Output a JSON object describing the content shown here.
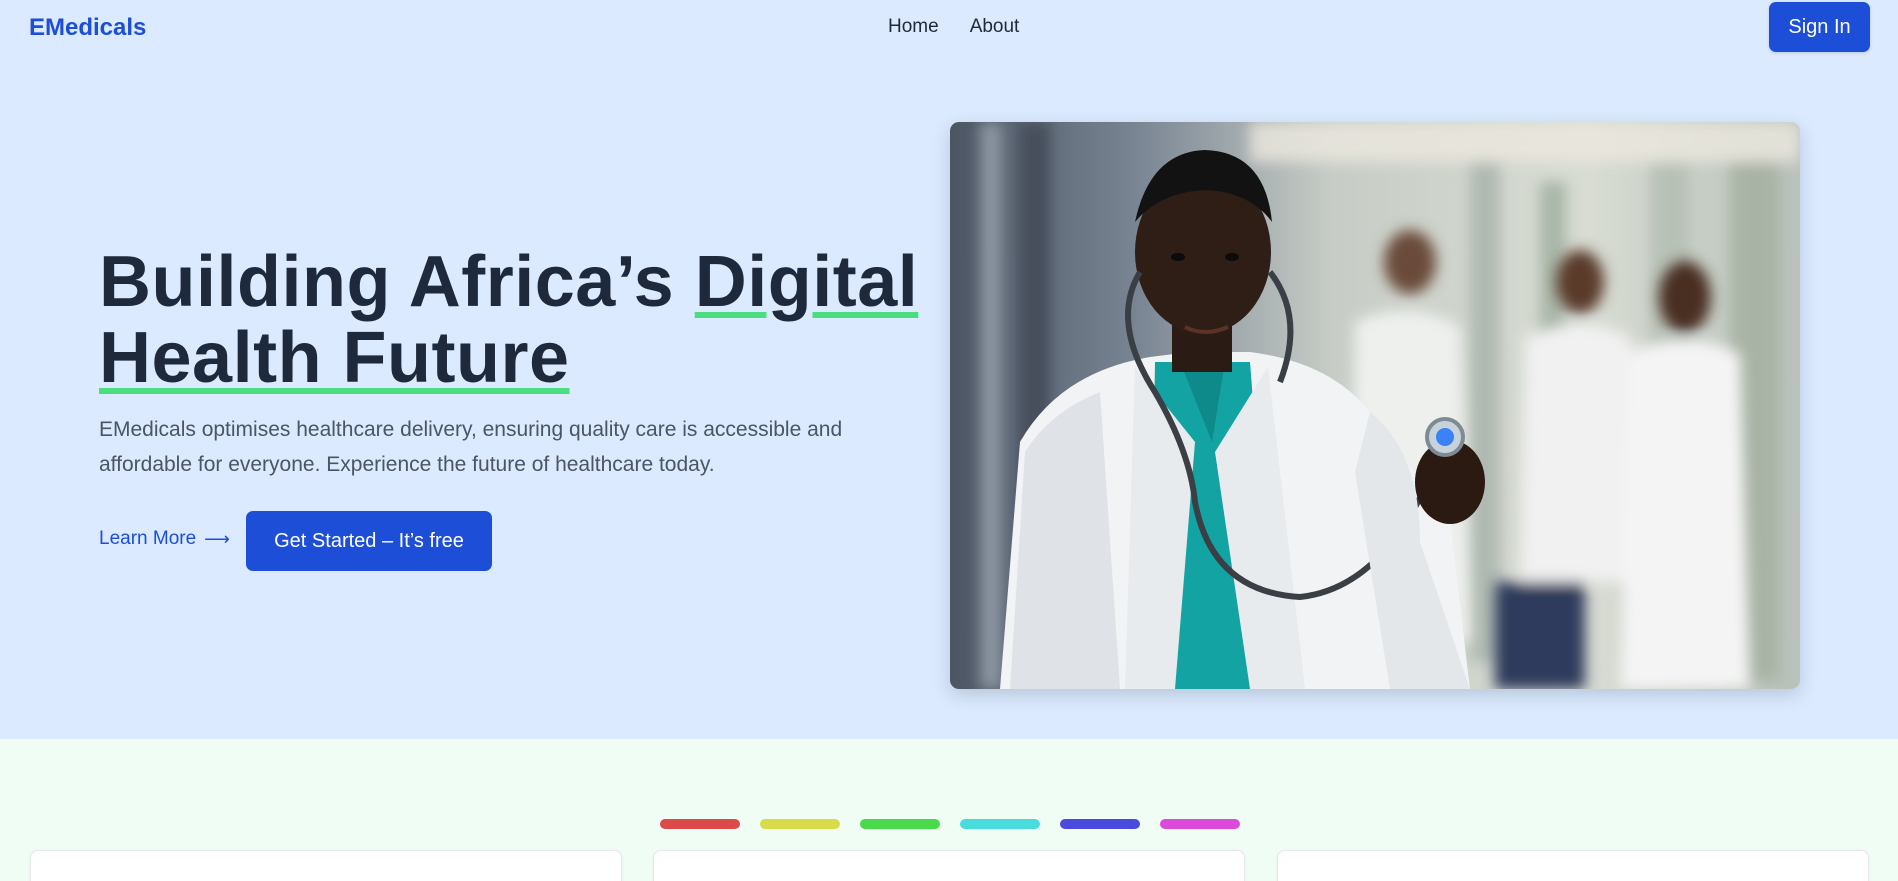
{
  "brand": "EMedicals",
  "nav": {
    "items": [
      {
        "label": "Home"
      },
      {
        "label": "About"
      }
    ],
    "sign_in": "Sign In"
  },
  "hero": {
    "headline_part1": "Building Africa’s ",
    "headline_part2": "Digital",
    "headline_part3": "Health Future",
    "subtext": "EMedicals optimises healthcare delivery, ensuring quality care is accessible and affordable for everyone. Experience the future of healthcare today.",
    "learn_more": "Learn More",
    "learn_more_arrow": "⟶",
    "get_started": "Get Started – It’s free"
  },
  "colors": {
    "brand": "#1d4ed8",
    "hero_bg": "#dbeafe",
    "section_bg": "#f0fdf4",
    "underline": "#4ade80",
    "pills": [
      "#dc4a4a",
      "#d9dc4a",
      "#4ad94a",
      "#4adcdc",
      "#4a4adc",
      "#dc4adc"
    ]
  }
}
